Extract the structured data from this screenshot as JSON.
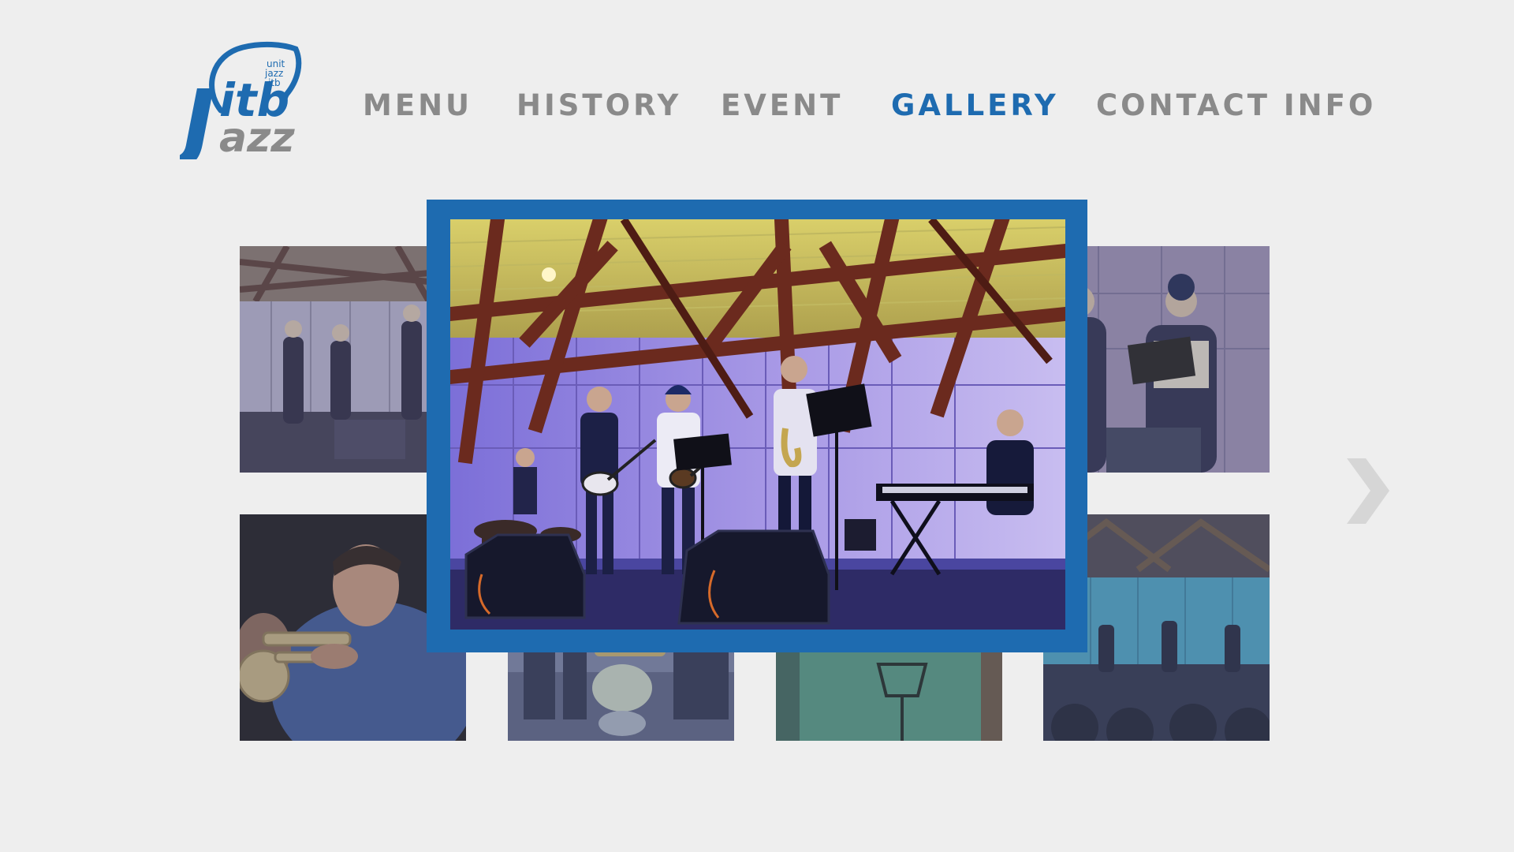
{
  "logo": {
    "small_lines": [
      "unit",
      "jazz",
      "itb"
    ],
    "main_top": "itb",
    "main_bottom": "azz",
    "letter_j": "J",
    "colors": {
      "blue": "#1e6bb0",
      "gray": "#8a8a8a"
    }
  },
  "nav": {
    "items": [
      {
        "label": "MENU"
      },
      {
        "label": "HISTORY"
      },
      {
        "label": "EVENT"
      },
      {
        "label": "GALLERY",
        "active": true
      },
      {
        "label": "CONTACT INFO"
      }
    ]
  },
  "gallery": {
    "featured_frame_color": "#1e6bb0",
    "next_icon": "chevron-right-icon"
  },
  "colors": {
    "background": "#eeeeee",
    "accent": "#1e6bb0",
    "nav_inactive": "#8a8a8a",
    "arrow": "#d6d6d6"
  }
}
